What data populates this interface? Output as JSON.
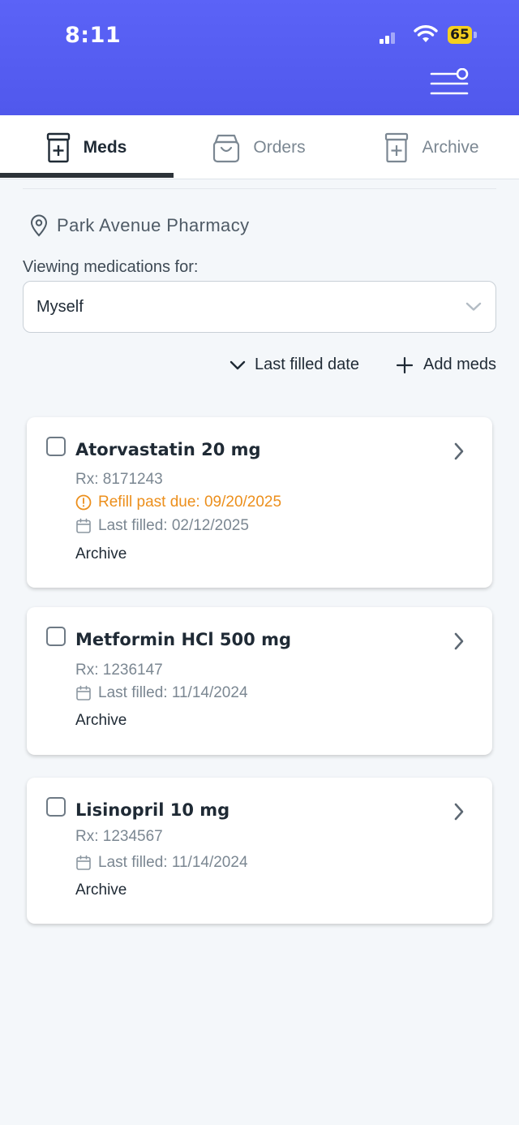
{
  "status_bar": {
    "time": "8:11",
    "battery": "65"
  },
  "colors": {
    "header": "#5b63f7",
    "alert": "#ec8f1c",
    "active_tab": "#2c3238"
  },
  "tabs": [
    {
      "label": "Meds",
      "icon": "pill-bottle-icon",
      "active": true
    },
    {
      "label": "Orders",
      "icon": "shopping-bag-icon",
      "active": false
    },
    {
      "label": "Archive",
      "icon": "archive-bottle-icon",
      "active": false
    }
  ],
  "pharmacy": {
    "name": "Park Avenue Pharmacy"
  },
  "viewing": {
    "label": "Viewing medications for:",
    "selected": "Myself"
  },
  "actions": {
    "sort_label": "Last filled date",
    "add_label": "Add meds"
  },
  "medications": [
    {
      "name": "Atorvastatin 20 mg",
      "rx": "Rx: 8171243",
      "alert": "Refill past due: 09/20/2025",
      "last_filled": "Last filled: 02/12/2025",
      "archive_label": "Archive"
    },
    {
      "name": "Metformin HCl 500 mg",
      "rx": "Rx: 1236147",
      "last_filled": "Last filled: 11/14/2024",
      "archive_label": "Archive"
    },
    {
      "name": "Lisinopril 10 mg",
      "rx": "Rx: 1234567",
      "last_filled": "Last filled: 11/14/2024",
      "archive_label": "Archive"
    }
  ]
}
